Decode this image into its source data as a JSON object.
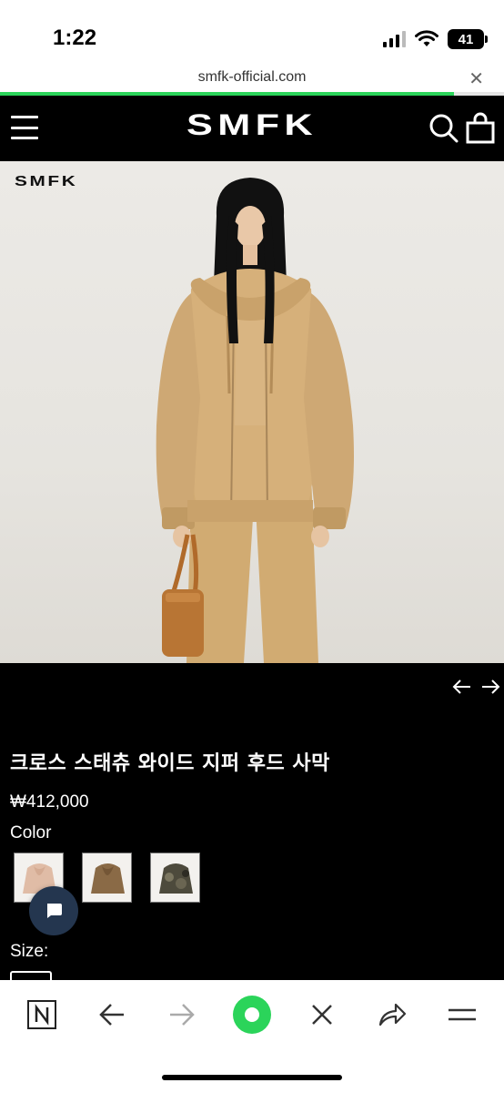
{
  "status_bar": {
    "time": "1:22",
    "battery": "41"
  },
  "browser": {
    "url": "smfk-official.com",
    "load_progress": 0.9
  },
  "header": {
    "logo": "SMFK"
  },
  "hero": {
    "watermark": "SMFK"
  },
  "product": {
    "title": "크로스 스태츄 와이드 지퍼 후드 사막",
    "price": "₩412,000",
    "color_label": "Color",
    "size_label": "Size:",
    "colors": [
      "sand-pink",
      "brown",
      "camo"
    ]
  },
  "colors": {
    "accent_green": "#2bd45a",
    "chat_bubble": "#24364f",
    "background": "#000000"
  },
  "toolbar": {
    "icons": [
      "naver-n-icon",
      "back-arrow-icon",
      "forward-arrow-icon",
      "green-dot-icon",
      "close-icon",
      "share-icon",
      "menu-icon"
    ]
  }
}
